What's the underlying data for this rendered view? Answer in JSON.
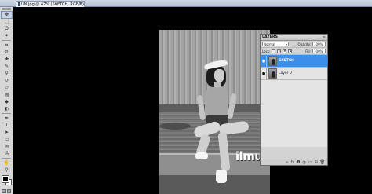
{
  "document": {
    "tab_title": "UN.jpg @ 47% (SKETCH, RGB/8)",
    "close_glyph": "×"
  },
  "tools": [
    {
      "name": "move-tool",
      "glyph": "✥",
      "active": true
    },
    {
      "name": "marquee-tool",
      "glyph": "⬚"
    },
    {
      "name": "lasso-tool",
      "glyph": "ʘ"
    },
    {
      "name": "magic-wand-tool",
      "glyph": "✦"
    },
    {
      "name": "crop-tool",
      "glyph": "⌗"
    },
    {
      "name": "slice-tool",
      "glyph": "⧄"
    },
    {
      "name": "healing-brush-tool",
      "glyph": "✚"
    },
    {
      "name": "brush-tool",
      "glyph": "✎"
    },
    {
      "name": "clone-stamp-tool",
      "glyph": "⚲"
    },
    {
      "name": "history-brush-tool",
      "glyph": "↺"
    },
    {
      "name": "eraser-tool",
      "glyph": "▱"
    },
    {
      "name": "gradient-tool",
      "glyph": "▤"
    },
    {
      "name": "blur-tool",
      "glyph": "◆"
    },
    {
      "name": "dodge-tool",
      "glyph": "◐"
    },
    {
      "name": "pen-tool",
      "glyph": "✒"
    },
    {
      "name": "type-tool",
      "glyph": "T"
    },
    {
      "name": "path-selection-tool",
      "glyph": "➤"
    },
    {
      "name": "shape-tool",
      "glyph": "▭"
    },
    {
      "name": "notes-tool",
      "glyph": "✉"
    },
    {
      "name": "eyedropper-tool",
      "glyph": "⚗"
    },
    {
      "name": "hand-tool",
      "glyph": "✋"
    },
    {
      "name": "zoom-tool",
      "glyph": "⚲"
    }
  ],
  "watermark": "ilmuonline.net",
  "layers_panel": {
    "tab_label": "LAYERS",
    "menu_glyph": "≡",
    "blend_mode": "Normal",
    "opacity_label": "Opacity:",
    "opacity_value": "100%",
    "lock_label": "Lock:",
    "fill_label": "Fill:",
    "fill_value": "100%",
    "layers": [
      {
        "name": "SKETCH",
        "selected": true,
        "visible": true
      },
      {
        "name": "Layer 0",
        "selected": false,
        "visible": true
      }
    ],
    "footer_icons": [
      "link-icon",
      "fx-icon",
      "mask-icon",
      "adjustment-icon",
      "folder-icon",
      "new-layer-icon",
      "trash-icon"
    ],
    "footer_glyphs": [
      "∞",
      "fx",
      "◘",
      "◑",
      "▭",
      "⊞",
      "🗑"
    ]
  },
  "colors": {
    "selection_blue": "#3d8ee8",
    "foreground": "#000000",
    "background": "#ffffff"
  }
}
